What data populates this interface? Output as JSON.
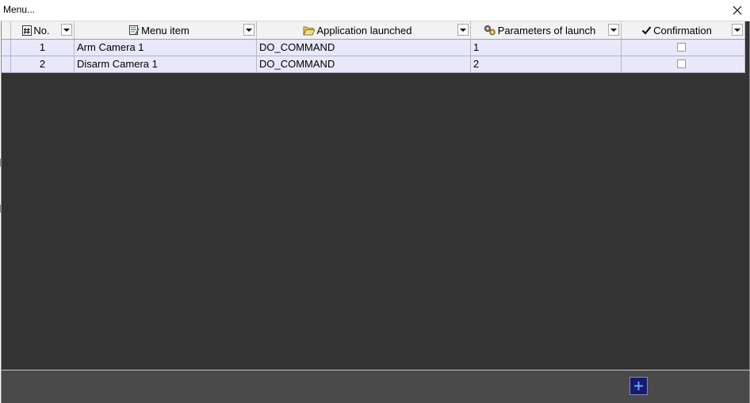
{
  "window": {
    "title": "Menu..."
  },
  "columns": [
    {
      "key": "no",
      "label": "No.",
      "icon": "hash-icon"
    },
    {
      "key": "menu_item",
      "label": "Menu item",
      "icon": "menu-item-icon"
    },
    {
      "key": "app",
      "label": "Application launched",
      "icon": "open-folder-icon"
    },
    {
      "key": "params",
      "label": "Parameters of launch",
      "icon": "gears-icon"
    },
    {
      "key": "confirm",
      "label": "Confirmation",
      "icon": "checkmark-icon"
    }
  ],
  "rows": [
    {
      "no": "1",
      "menu_item": "Arm Camera 1",
      "app": "DO_COMMAND",
      "params": "1",
      "confirmation": false
    },
    {
      "no": "2",
      "menu_item": "Disarm Camera 1",
      "app": "DO_COMMAND",
      "params": "2",
      "confirmation": false
    }
  ],
  "footer": {
    "add_button_icon": "plus-icon"
  },
  "colors": {
    "row_bg": "#e8e8fa",
    "client_bg": "#333333",
    "footer_bg": "#4a4a4a",
    "accent": "#1a1a6a"
  }
}
